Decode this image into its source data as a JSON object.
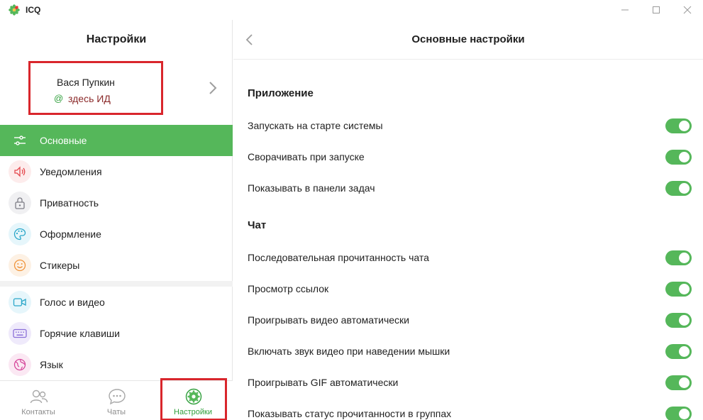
{
  "window": {
    "title": "ICQ",
    "brand_color": "#55b75a"
  },
  "left_panel": {
    "title": "Настройки",
    "profile": {
      "name": "Вася Пупкин",
      "id_prefix": "@",
      "id": "здесь ИД"
    },
    "menu": [
      {
        "label": "Основные",
        "icon": "sliders-icon",
        "active": true
      },
      {
        "label": "Уведомления",
        "icon": "speaker-icon",
        "active": false
      },
      {
        "label": "Приватность",
        "icon": "lock-icon",
        "active": false
      },
      {
        "label": "Оформление",
        "icon": "palette-icon",
        "active": false
      },
      {
        "label": "Стикеры",
        "icon": "smile-icon",
        "active": false
      },
      {
        "label": "Голос и видео",
        "icon": "video-camera-icon",
        "active": false
      },
      {
        "label": "Горячие клавиши",
        "icon": "keyboard-icon",
        "active": false
      },
      {
        "label": "Язык",
        "icon": "globe-icon",
        "active": false
      }
    ],
    "bottom_nav": [
      {
        "label": "Контакты",
        "icon": "contacts-icon"
      },
      {
        "label": "Чаты",
        "icon": "chat-bubble-icon"
      },
      {
        "label": "Настройки",
        "icon": "gear-icon",
        "active": true
      }
    ]
  },
  "right_panel": {
    "title": "Основные настройки",
    "sections": [
      {
        "title": "Приложение",
        "settings": [
          {
            "label": "Запускать на старте системы",
            "enabled": true
          },
          {
            "label": "Сворачивать при запуске",
            "enabled": true
          },
          {
            "label": "Показывать в панели задач",
            "enabled": true
          }
        ]
      },
      {
        "title": "Чат",
        "settings": [
          {
            "label": "Последовательная прочитанность чата",
            "enabled": true
          },
          {
            "label": "Просмотр ссылок",
            "enabled": true
          },
          {
            "label": "Проигрывать видео автоматически",
            "enabled": true
          },
          {
            "label": "Включать звук видео при наведении мышки",
            "enabled": true
          },
          {
            "label": "Проигрывать GIF автоматически",
            "enabled": true
          },
          {
            "label": "Показывать статус прочитанности в группах",
            "enabled": true
          }
        ]
      }
    ]
  }
}
